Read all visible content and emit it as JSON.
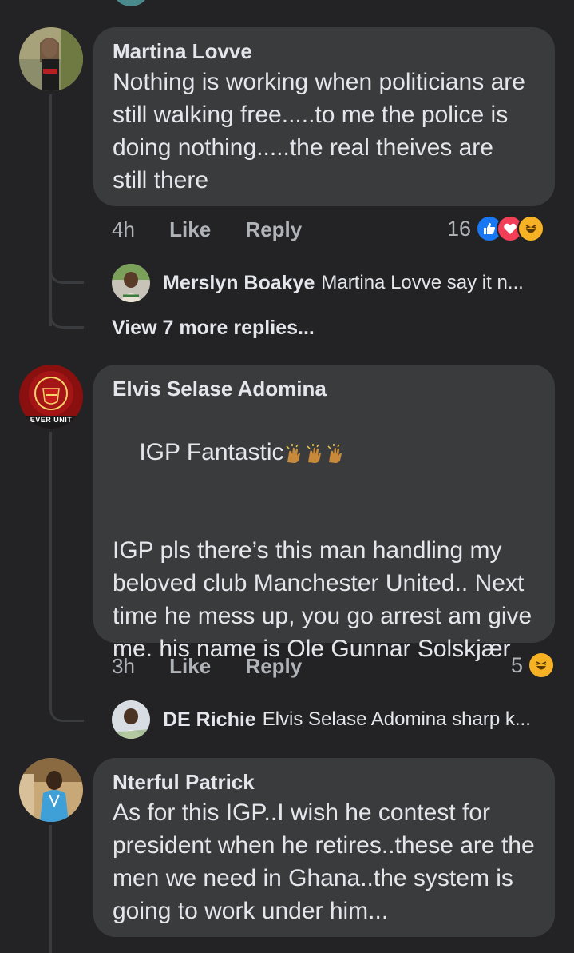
{
  "comments": [
    {
      "author": "Martina Lovve",
      "text": "Nothing is working when politicians are still walking free.....to me the police is doing nothing.....the real theives are still there",
      "time": "4h",
      "like_label": "Like",
      "reply_label": "Reply",
      "reaction_count": "16",
      "reactions": [
        "like-icon",
        "love-icon",
        "haha-icon"
      ],
      "reply_preview": {
        "name": "Merslyn Boakye",
        "text": "Martina Lovve say it n..."
      },
      "view_more": "View 7 more replies..."
    },
    {
      "author": "Elvis Selase Adomina",
      "text_line1": "IGP Fantastic",
      "text_rest": "IGP pls there’s this man handling my beloved club Manchester United.. Next time he mess up, you go arrest am give me. his name is Ole Gunnar Solskjær",
      "time": "3h",
      "like_label": "Like",
      "reply_label": "Reply",
      "reaction_count": "5",
      "reactions": [
        "haha-icon"
      ],
      "avatar_text": "EVER UNIT",
      "reply_preview": {
        "name": "DE Richie",
        "text": "Elvis Selase Adomina sharp k..."
      }
    },
    {
      "author": "Nterful Patrick",
      "text": "As for this IGP..I wish he contest for president when he retires..these are the men we need in Ghana..the system is going to work under him..."
    }
  ],
  "colors": {
    "background": "#232325",
    "bubble": "#3a3b3c",
    "like_blue": "#1877f2",
    "love_red": "#f33e58",
    "haha_yellow": "#f7b125"
  }
}
